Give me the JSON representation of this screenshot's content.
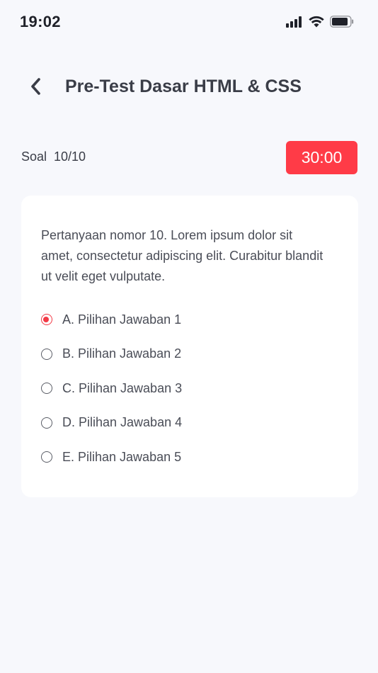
{
  "status_bar": {
    "time": "19:02",
    "icons": [
      "signal-icon",
      "wifi-icon",
      "battery-icon"
    ]
  },
  "header": {
    "back_icon": "chevron-left-icon",
    "title": "Pre-Test Dasar HTML & CSS"
  },
  "quiz": {
    "counter_label": "Soal  10/10",
    "timer": "30:00",
    "timer_color": "#FF3B47"
  },
  "question": {
    "text": "Pertanyaan nomor 10.  Lorem ipsum dolor sit amet, consectetur adipiscing elit. Curabitur blandit ut velit eget vulputate.",
    "options": [
      {
        "label": "A. Pilihan Jawaban 1",
        "selected": true
      },
      {
        "label": "B. Pilihan Jawaban 2",
        "selected": false
      },
      {
        "label": "C. Pilihan Jawaban 3",
        "selected": false
      },
      {
        "label": "D. Pilihan Jawaban 4",
        "selected": false
      },
      {
        "label": "E. Pilihan Jawaban 5",
        "selected": false
      }
    ]
  },
  "colors": {
    "background": "#F7F8FC",
    "card": "#FFFFFF",
    "accent": "#F23A46",
    "text": "#3A3D47"
  }
}
